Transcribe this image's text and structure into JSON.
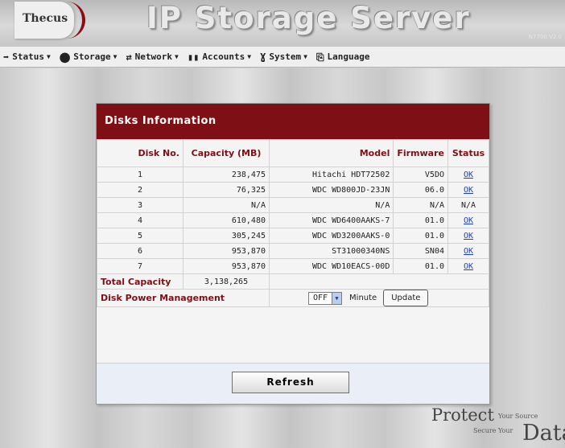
{
  "header": {
    "logo_text": "Thecus",
    "title": "IP Storage Server",
    "version": "N7700 V2.0"
  },
  "nav": [
    {
      "icon": "status-icon",
      "label": "Status"
    },
    {
      "icon": "storage-icon",
      "label": "Storage"
    },
    {
      "icon": "network-icon",
      "label": "Network"
    },
    {
      "icon": "accounts-icon",
      "label": "Accounts"
    },
    {
      "icon": "system-icon",
      "label": "System"
    },
    {
      "icon": "language-icon",
      "label": "Language"
    }
  ],
  "panel": {
    "title": "Disks Information",
    "columns": {
      "disk_no": "Disk No.",
      "capacity": "Capacity (MB)",
      "model": "Model",
      "firmware": "Firmware",
      "status": "Status"
    },
    "rows": [
      {
        "disk_no": "1",
        "capacity": "238,475",
        "model": "Hitachi HDT72502",
        "firmware": "V5DO",
        "status": "OK"
      },
      {
        "disk_no": "2",
        "capacity": "76,325",
        "model": "WDC WD800JD-23JN",
        "firmware": "06.0",
        "status": "OK"
      },
      {
        "disk_no": "3",
        "capacity": "N/A",
        "model": "N/A",
        "firmware": "N/A",
        "status": "N/A"
      },
      {
        "disk_no": "4",
        "capacity": "610,480",
        "model": "WDC WD6400AAKS-7",
        "firmware": "01.0",
        "status": "OK"
      },
      {
        "disk_no": "5",
        "capacity": "305,245",
        "model": "WDC WD3200AAKS-0",
        "firmware": "01.0",
        "status": "OK"
      },
      {
        "disk_no": "6",
        "capacity": "953,870",
        "model": "ST31000340NS",
        "firmware": "SN04",
        "status": "OK"
      },
      {
        "disk_no": "7",
        "capacity": "953,870",
        "model": "WDC WD10EACS-00D",
        "firmware": "01.0",
        "status": "OK"
      }
    ],
    "total_label": "Total Capacity",
    "total_value": "3,138,265",
    "power_label": "Disk Power Management",
    "power_value": "OFF",
    "power_unit": "Minute",
    "update_label": "Update",
    "refresh_label": "Refresh"
  },
  "brand": {
    "protect": "Protect",
    "your_source": "Your Source",
    "secure_your": "Secure Your",
    "data": "Data"
  },
  "colors": {
    "accent": "#7e1015",
    "link": "#1b3fc4"
  }
}
